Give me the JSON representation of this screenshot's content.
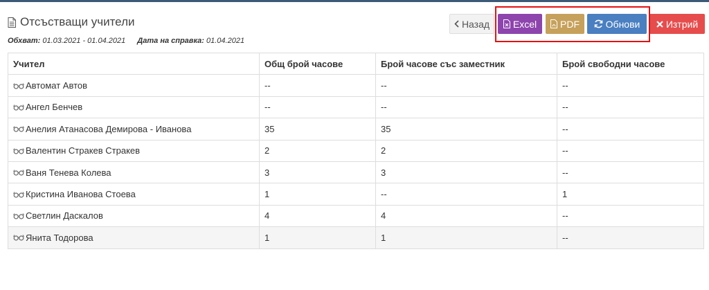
{
  "header": {
    "title": "Отсъстващи учители",
    "scope_label": "Обхват:",
    "scope_value": "01.03.2021 - 01.04.2021",
    "report_date_label": "Дата на справка:",
    "report_date_value": "01.04.2021"
  },
  "toolbar": {
    "back_label": "Назад",
    "excel_label": "Excel",
    "pdf_label": "PDF",
    "refresh_label": "Обнови",
    "delete_label": "Изтрий"
  },
  "colors": {
    "excel": "#8e44ad",
    "pdf": "#c6a15b",
    "refresh": "#4a7fc1",
    "delete": "#e74c4c",
    "highlight": "#e41010"
  },
  "table": {
    "headers": [
      "Учител",
      "Общ брой часове",
      "Брой часове със заместник",
      "Брой свободни часове"
    ],
    "rows": [
      {
        "teacher": "Автомат Автов",
        "total": "--",
        "substitute": "--",
        "free": "--"
      },
      {
        "teacher": "Ангел Бенчев",
        "total": "--",
        "substitute": "--",
        "free": "--"
      },
      {
        "teacher": "Анелия Атанасова Демирова - Иванова",
        "total": "35",
        "substitute": "35",
        "free": "--"
      },
      {
        "teacher": "Валентин Стракев Стракев",
        "total": "2",
        "substitute": "2",
        "free": "--"
      },
      {
        "teacher": "Ваня Тенева Колева",
        "total": "3",
        "substitute": "3",
        "free": "--"
      },
      {
        "teacher": "Кристина Иванова Стоева",
        "total": "1",
        "substitute": "--",
        "free": "1"
      },
      {
        "teacher": "Светлин Даскалов",
        "total": "4",
        "substitute": "4",
        "free": "--"
      },
      {
        "teacher": "Янита Тодорова",
        "total": "1",
        "substitute": "1",
        "free": "--"
      }
    ]
  }
}
